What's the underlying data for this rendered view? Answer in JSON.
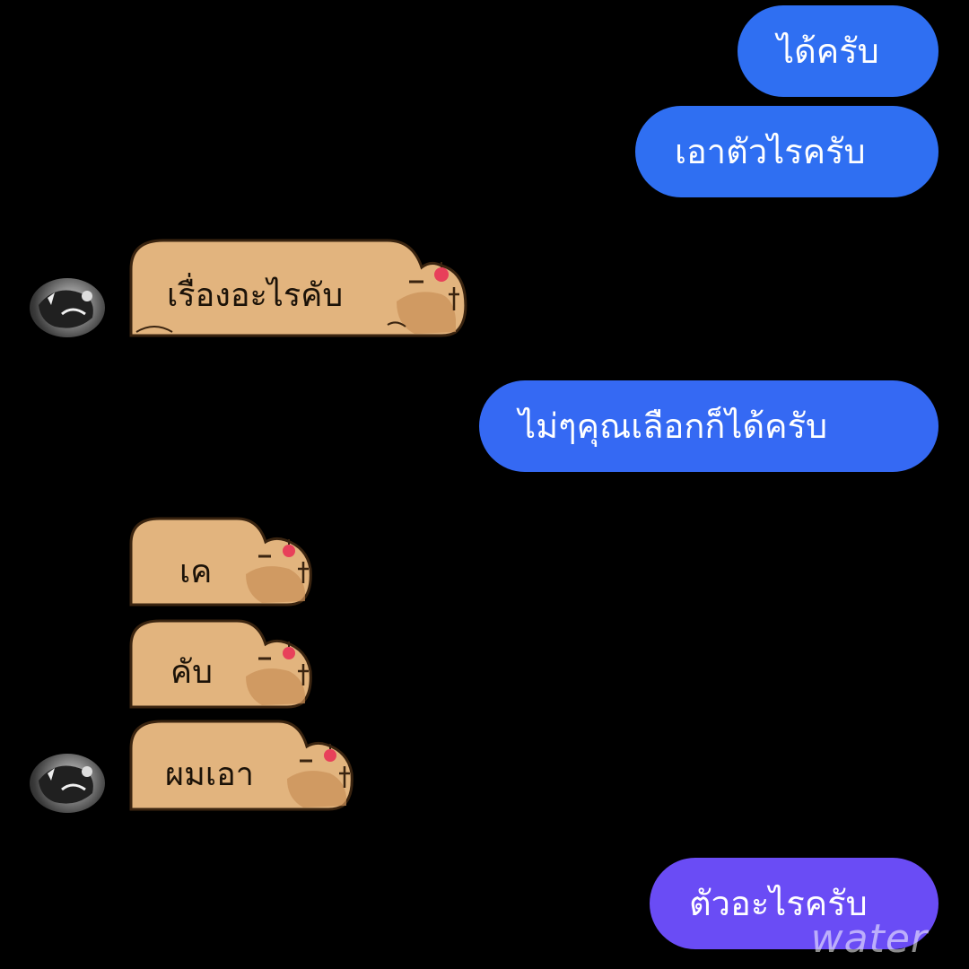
{
  "colors": {
    "background": "#000000",
    "outgoing_bubble_blue": "#2f6ff2",
    "outgoing_bubble_purple": "#6a4cf5",
    "capybara_body": "#e2b47e",
    "capybara_outline": "#3a2410"
  },
  "messages": {
    "m1": {
      "direction": "outgoing",
      "text": "ได้ครับ"
    },
    "m2": {
      "direction": "outgoing",
      "text": "เอาตัวไรครับ"
    },
    "m3": {
      "direction": "incoming",
      "text": "เรื่องอะไรคับ",
      "sticker": "capybara-bubble"
    },
    "m4": {
      "direction": "outgoing",
      "text": "ไม่ๆคุณเลือกก็ได้ครับ"
    },
    "m5": {
      "direction": "incoming",
      "text": "เค",
      "sticker": "capybara-bubble"
    },
    "m6": {
      "direction": "incoming",
      "text": "คับ",
      "sticker": "capybara-bubble"
    },
    "m7": {
      "direction": "incoming",
      "text": "ผมเอา",
      "sticker": "capybara-bubble"
    },
    "m8": {
      "direction": "outgoing",
      "text": "ตัวอะไรครับ"
    }
  },
  "avatar": {
    "icon": "user-avatar-icon"
  },
  "watermark": "water"
}
